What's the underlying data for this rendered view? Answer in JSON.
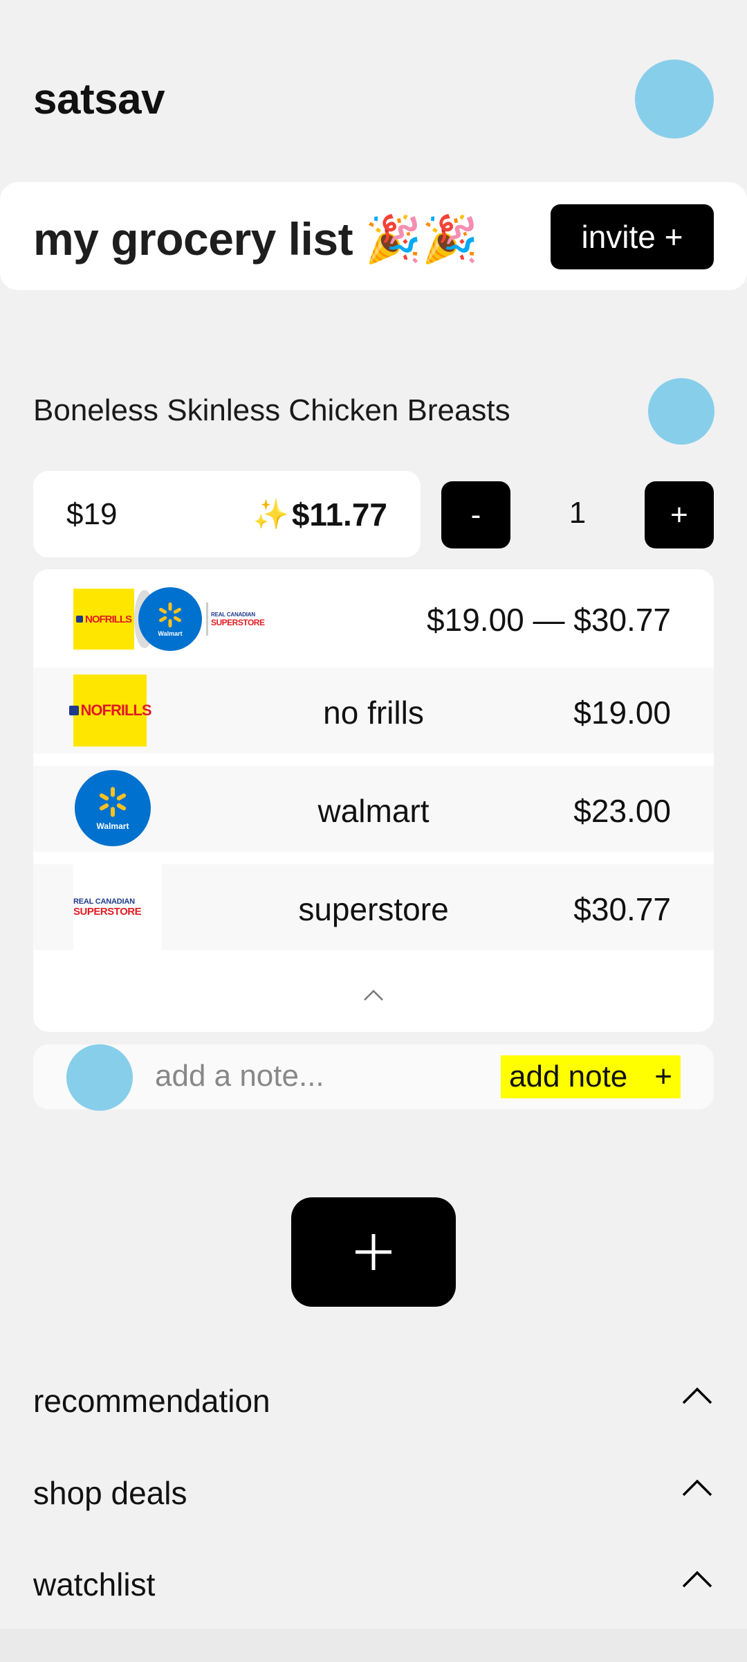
{
  "header": {
    "username": "satsav"
  },
  "list": {
    "title": "my grocery list 🎉🎉",
    "invite_label": "invite +"
  },
  "item": {
    "name": "Boneless Skinless Chicken Breasts",
    "price_original": "$19",
    "deal_icon": "✨",
    "price_deal": "$11.77",
    "qty_minus": "-",
    "qty_plus": "+",
    "quantity": "1",
    "price_range": "$19.00 — $30.77",
    "stores": [
      {
        "name": "no frills",
        "price": "$19.00",
        "logo": "nofrills-logo",
        "logo_text": "NOFRILLS"
      },
      {
        "name": "walmart",
        "price": "$23.00",
        "logo": "walmart-logo",
        "logo_text": "Walmart"
      },
      {
        "name": "superstore",
        "price": "$30.77",
        "logo": "superstore-logo",
        "logo_text_small": "REAL CANADIAN",
        "logo_text_big": "SUPERSTORE"
      }
    ]
  },
  "note": {
    "placeholder": "add a note...",
    "button_label": "add note",
    "button_icon": "+"
  },
  "sections": [
    {
      "label": "recommendation"
    },
    {
      "label": "shop deals"
    },
    {
      "label": "watchlist"
    }
  ],
  "colors": {
    "background": "#f1f1f1",
    "avatar": "#87ceeb",
    "button": "#000000",
    "note_highlight": "#ffff00"
  }
}
